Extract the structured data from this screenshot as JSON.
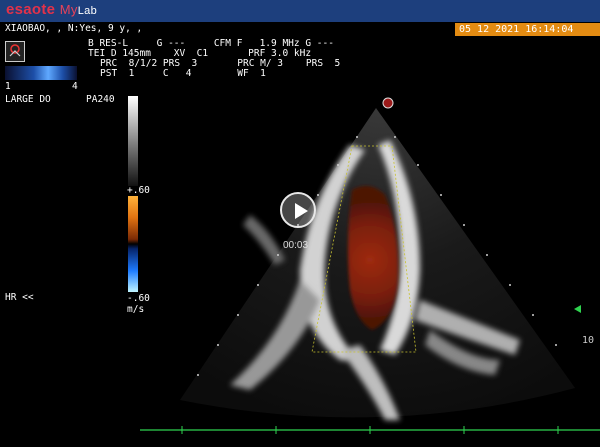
{
  "brand": {
    "name": "esaote",
    "product": "My",
    "suffix": "Lab"
  },
  "patient": {
    "line": "XIAOBAO, , N:Yes, 9 y, ,"
  },
  "datetime": "05 12 2021 16:14:04",
  "params": {
    "line1": "B RES-L     G ---     CFM F   1.9 MHz G ---",
    "line2": "TEI D 145mm    XV  C1       PRF 3.0 kHz",
    "line3": "PRC  8/1/2 PRS  3       PRC M/ 3    PRS  5",
    "line4": "PST  1     C   4        WF  1"
  },
  "probe": {
    "icon": "probe-icon",
    "tick_left": "1",
    "tick_right": "4"
  },
  "preset": {
    "label": "LARGE DO",
    "power": "PA240"
  },
  "color_scale": {
    "top": "+.60",
    "bottom": "-.60",
    "unit": "m/s"
  },
  "hr_label": "HR <<",
  "depth_label": "10",
  "video": {
    "icon": "play-icon",
    "time": "00:03"
  },
  "colors": {
    "topbar": "#1d3f7d",
    "brand": "#e2324a",
    "date_bg": "#e38b12",
    "ecg": "#2fd34f"
  }
}
